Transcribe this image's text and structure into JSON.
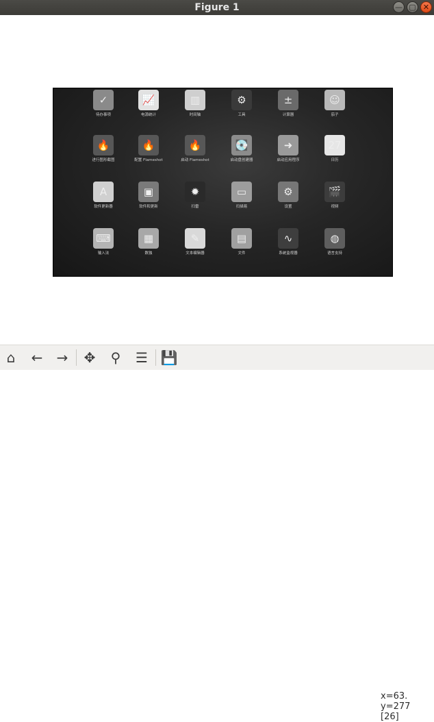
{
  "window": {
    "title": "Figure 1",
    "buttons": {
      "minimize": "—",
      "maximize": "▢",
      "close": "✕"
    }
  },
  "figure": {
    "apps": [
      {
        "row": 0,
        "col": 0,
        "label": "待办事项",
        "icon": "checkbox-todo-icon",
        "glyph": "✓",
        "color": "#8a8a8a"
      },
      {
        "row": 0,
        "col": 1,
        "label": "电源统计",
        "icon": "power-stats-chart-icon",
        "glyph": "📈",
        "color": "#e2e2e2"
      },
      {
        "row": 0,
        "col": 2,
        "label": "时间轴",
        "icon": "timeline-icon",
        "glyph": "▥",
        "color": "#cfcfcf"
      },
      {
        "row": 0,
        "col": 3,
        "label": "工具",
        "icon": "tools-icon",
        "glyph": "⚙",
        "color": "#3a3a3a"
      },
      {
        "row": 0,
        "col": 4,
        "label": "计算器",
        "icon": "calculator-icon",
        "glyph": "±",
        "color": "#6a6a6a"
      },
      {
        "row": 0,
        "col": 5,
        "label": "茄子",
        "icon": "cheese-camera-icon",
        "glyph": "☺",
        "color": "#b9b9b9"
      },
      {
        "row": 1,
        "col": 0,
        "label": "进行图形截图",
        "icon": "flameshot-capture-icon",
        "glyph": "🔥",
        "color": "#575757"
      },
      {
        "row": 1,
        "col": 1,
        "label": "配置 Flameshot",
        "icon": "flameshot-config-icon",
        "glyph": "🔥",
        "color": "#575757"
      },
      {
        "row": 1,
        "col": 2,
        "label": "启动 Flameshot",
        "icon": "flameshot-launch-icon",
        "glyph": "🔥",
        "color": "#575757"
      },
      {
        "row": 1,
        "col": 3,
        "label": "启动盘创建器",
        "icon": "startup-disk-creator-icon",
        "glyph": "💽",
        "color": "#8c8c8c"
      },
      {
        "row": 1,
        "col": 4,
        "label": "启动应用程序",
        "icon": "startup-applications-icon",
        "glyph": "➜",
        "color": "#9a9a9a"
      },
      {
        "row": 1,
        "col": 5,
        "label": "日历",
        "icon": "calendar-icon",
        "glyph": "27",
        "color": "#e6e6e6"
      },
      {
        "row": 2,
        "col": 0,
        "label": "软件更新器",
        "icon": "software-updater-icon",
        "glyph": "A",
        "color": "#d0d0d0"
      },
      {
        "row": 2,
        "col": 1,
        "label": "软件和更新",
        "icon": "software-and-updates-icon",
        "glyph": "▣",
        "color": "#7a7a7a"
      },
      {
        "row": 2,
        "col": 2,
        "label": "扫雷",
        "icon": "mines-icon",
        "glyph": "✹",
        "color": "#2a2a2a"
      },
      {
        "row": 2,
        "col": 3,
        "label": "扫描易",
        "icon": "scanner-icon",
        "glyph": "▭",
        "color": "#9d9d9d"
      },
      {
        "row": 2,
        "col": 4,
        "label": "设置",
        "icon": "settings-gear-icon",
        "glyph": "⚙",
        "color": "#777777"
      },
      {
        "row": 2,
        "col": 5,
        "label": "视频",
        "icon": "video-clapper-icon",
        "glyph": "🎬",
        "color": "#3c3c3c"
      },
      {
        "row": 3,
        "col": 0,
        "label": "输入法",
        "icon": "keyboard-input-method-icon",
        "glyph": "⌨",
        "color": "#b4b4b4"
      },
      {
        "row": 3,
        "col": 1,
        "label": "数独",
        "icon": "sudoku-icon",
        "glyph": "▦",
        "color": "#a8a8a8"
      },
      {
        "row": 3,
        "col": 2,
        "label": "文本编辑器",
        "icon": "text-editor-icon",
        "glyph": "✎",
        "color": "#d9d9d9"
      },
      {
        "row": 3,
        "col": 3,
        "label": "文件",
        "icon": "files-cabinet-icon",
        "glyph": "▤",
        "color": "#a0a0a0"
      },
      {
        "row": 3,
        "col": 4,
        "label": "系统监视器",
        "icon": "system-monitor-icon",
        "glyph": "∿",
        "color": "#3e3e3e"
      },
      {
        "row": 3,
        "col": 5,
        "label": "语言支持",
        "icon": "language-support-icon",
        "glyph": "◍",
        "color": "#5e5e5e"
      }
    ]
  },
  "toolbar": {
    "home": "⌂",
    "back": "←",
    "forward": "→",
    "pan": "✥",
    "zoom": "⚲",
    "subplots": "☰",
    "save": "💾"
  },
  "status": {
    "line1": "x=63. y=277",
    "line2": "[26]"
  }
}
